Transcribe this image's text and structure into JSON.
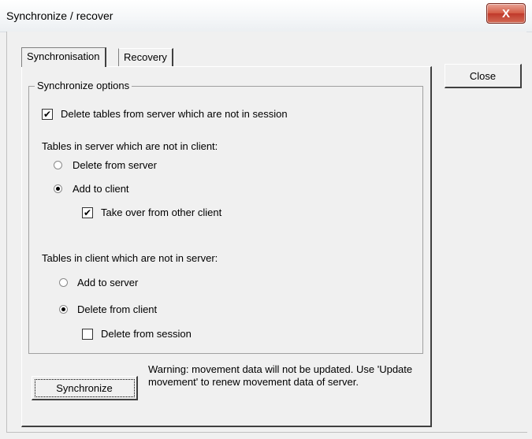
{
  "window": {
    "title": "Synchronize / recover",
    "close_glyph": "X"
  },
  "tabs": [
    {
      "label": "Synchronisation",
      "selected": true
    },
    {
      "label": "Recovery",
      "selected": false
    }
  ],
  "group": {
    "label": "Synchronize options"
  },
  "options": {
    "delete_tables": {
      "label": "Delete tables from server which are not in session",
      "checked": true,
      "check_glyph": "✔"
    },
    "server_not_in_client": {
      "heading": "Tables in server which are not in client:",
      "delete_from_server": {
        "label": "Delete from server",
        "selected": false
      },
      "add_to_client": {
        "label": "Add to client",
        "selected": true
      },
      "take_over": {
        "label": "Take over from other client",
        "checked": true,
        "check_glyph": "✔"
      }
    },
    "client_not_in_server": {
      "heading": "Tables in client which are not in server:",
      "add_to_server": {
        "label": "Add to server",
        "selected": false
      },
      "delete_from_client": {
        "label": "Delete from client",
        "selected": true
      },
      "delete_from_session": {
        "label": "Delete from session",
        "checked": false,
        "check_glyph": ""
      }
    }
  },
  "buttons": {
    "close": "Close",
    "synchronize": "Synchronize"
  },
  "warning": "Warning: movement data will not be updated. Use 'Update movement' to renew movement data of server."
}
